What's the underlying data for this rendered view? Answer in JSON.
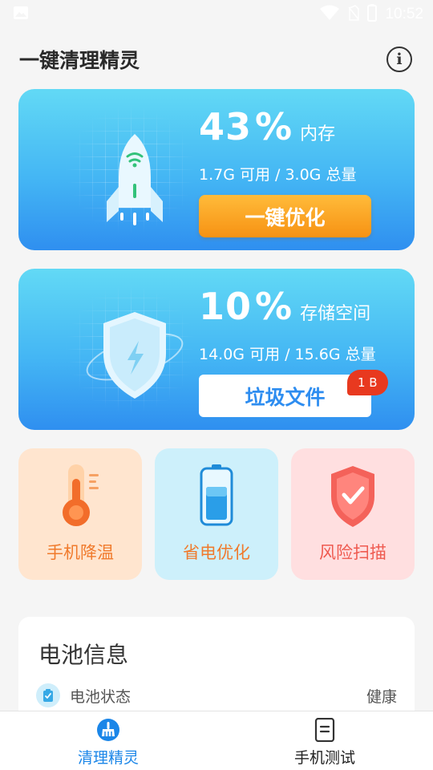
{
  "status_bar": {
    "time": "10:52"
  },
  "header": {
    "title": "一键清理精灵",
    "info_icon": "info-icon"
  },
  "memory_card": {
    "percent": "43",
    "percent_unit": "%",
    "label": "内存",
    "usage": "1.7G 可用 / 3.0G 总量",
    "button": "一键优化",
    "illustration": "rocket-icon"
  },
  "storage_card": {
    "percent": "10",
    "percent_unit": "%",
    "label": "存储空间",
    "usage": "14.0G 可用 / 15.6G 总量",
    "button": "垃圾文件",
    "badge": "1 B",
    "illustration": "shield-lightning-icon"
  },
  "tools": [
    {
      "label": "手机降温",
      "icon": "thermometer-icon"
    },
    {
      "label": "省电优化",
      "icon": "battery-icon"
    },
    {
      "label": "风险扫描",
      "icon": "shield-check-icon"
    }
  ],
  "battery_info": {
    "title": "电池信息",
    "rows": [
      {
        "label": "电池状态",
        "value": "健康",
        "icon": "battery-status-icon"
      }
    ]
  },
  "bottom_nav": {
    "items": [
      {
        "label": "清理精灵",
        "icon": "broom-icon",
        "active": true
      },
      {
        "label": "手机测试",
        "icon": "document-icon",
        "active": false
      }
    ]
  },
  "colors": {
    "accent_blue": "#1b86e8",
    "card_gradient_top": "#62d9f5",
    "card_gradient_bottom": "#2f8ff0",
    "optimize_orange": "#f79213",
    "badge_red": "#e8391f"
  }
}
